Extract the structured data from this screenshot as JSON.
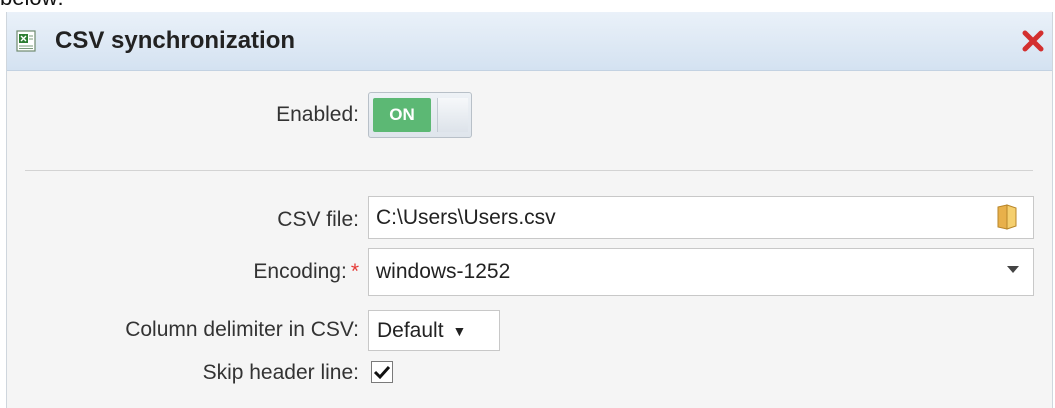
{
  "above_text": "below:",
  "window": {
    "title": "CSV synchronization",
    "icon": "csv-file-icon",
    "close_icon": "close-icon"
  },
  "enabled": {
    "label": "Enabled:",
    "toggle_text": "ON",
    "state": true
  },
  "csv_file": {
    "label": "CSV file:",
    "value": "C:\\Users\\Users.csv",
    "icon": "folder-icon"
  },
  "encoding": {
    "label": "Encoding:",
    "required_mark": "*",
    "value": "windows-1252"
  },
  "delimiter": {
    "label": "Column delimiter in CSV:",
    "value": "Default",
    "arrow": "▼"
  },
  "skip_header": {
    "label": "Skip header line:",
    "checked": true
  },
  "colors": {
    "toggle_on": "#5cb874",
    "title_bg": "#dbe7f3",
    "close": "#d32f2f",
    "required": "#e53935"
  }
}
